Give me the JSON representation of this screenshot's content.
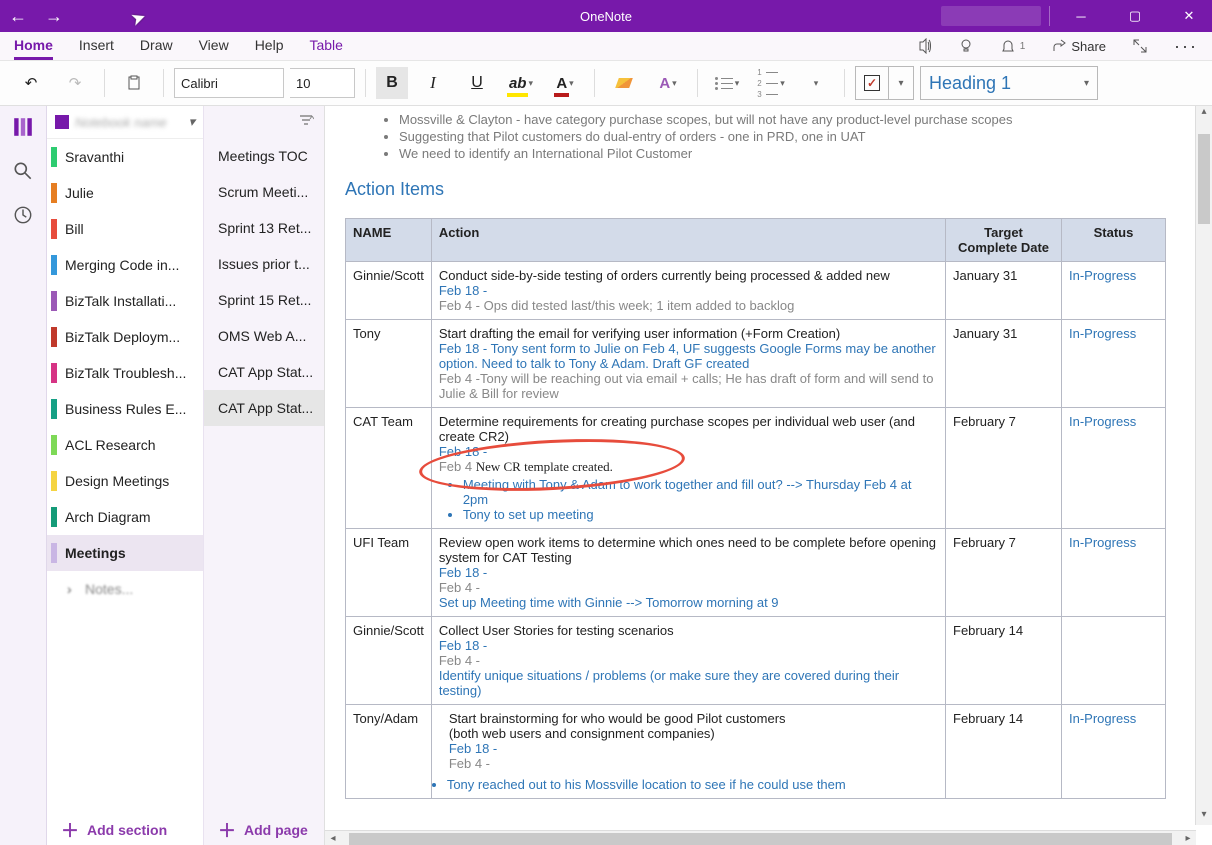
{
  "app": {
    "title": "OneNote"
  },
  "menubar": {
    "home": "Home",
    "insert": "Insert",
    "draw": "Draw",
    "view": "View",
    "help": "Help",
    "table": "Table",
    "share": "Share"
  },
  "ribbon": {
    "fontname": "Calibri",
    "fontsize": "10",
    "styleName": "Heading 1",
    "checkmark": "✓"
  },
  "sections": {
    "items": [
      {
        "label": "Sravanthi",
        "color": "#2ecc71"
      },
      {
        "label": "Julie",
        "color": "#e67e22"
      },
      {
        "label": "Bill",
        "color": "#e74c3c"
      },
      {
        "label": "Merging Code in...",
        "color": "#3498db"
      },
      {
        "label": "BizTalk Installati...",
        "color": "#9b59b6"
      },
      {
        "label": "BizTalk Deploym...",
        "color": "#c0392b"
      },
      {
        "label": "BizTalk Troublesh...",
        "color": "#d63384"
      },
      {
        "label": "Business Rules E...",
        "color": "#16a085"
      },
      {
        "label": "ACL Research",
        "color": "#7ed957"
      },
      {
        "label": "Design Meetings",
        "color": "#f5d442"
      },
      {
        "label": "Arch Diagram",
        "color": "#159b78"
      },
      {
        "label": "Meetings",
        "color": "#c9b6e4",
        "selected": true
      }
    ],
    "child": "Notes...",
    "addSection": "Add section"
  },
  "pages": {
    "items": [
      {
        "label": "Meetings TOC"
      },
      {
        "label": "Scrum Meeti..."
      },
      {
        "label": "Sprint 13 Ret..."
      },
      {
        "label": "Issues prior t..."
      },
      {
        "label": "Sprint 15 Ret..."
      },
      {
        "label": "OMS Web A..."
      },
      {
        "label": "CAT App Stat..."
      },
      {
        "label": "CAT App Stat...",
        "selected": true
      }
    ],
    "addPage": "Add page"
  },
  "note": {
    "bullets": [
      "Mossville & Clayton - have category purchase scopes, but will not have any product-level purchase scopes",
      "Suggesting that Pilot customers do dual-entry of orders - one in PRD, one in UAT",
      "We need to identify an International Pilot Customer"
    ],
    "heading": "Action Items",
    "th": {
      "name": "NAME",
      "action": "Action",
      "tcd": "Target Complete Date",
      "status": "Status"
    },
    "r1": {
      "name": "Ginnie/Scott",
      "a1": "Conduct side-by-side testing of orders currently being processed & added new",
      "a2": "Feb 18 -",
      "a3": "Feb 4 - Ops did tested last/this week; 1 item added to backlog",
      "tcd": "January 31",
      "status": "In-Progress"
    },
    "r2": {
      "name": "Tony",
      "a1": "Start drafting the email for verifying user information (+Form Creation)",
      "a2": "Feb 18 - Tony sent form to Julie on Feb 4,    UF suggests Google Forms may be another option.  Need to talk to Tony & Adam.  Draft GF created",
      "a3": "Feb 4 -Tony will be reaching out via email + calls; He has draft of form and will send to Julie & Bill for review",
      "tcd": "January 31",
      "status": "In-Progress"
    },
    "r3": {
      "name": "CAT Team",
      "a1": "Determine requirements for creating purchase scopes per individual web user (and create CR2)",
      "a2": "Feb 18 -",
      "a3": "Feb 4 ",
      "a4": "New CR template created.",
      "b1": "Meeting with Tony & Adam to work together and fill out? --> Thursday Feb 4 at 2pm",
      "b2": "Tony to set up meeting",
      "tcd": "February 7",
      "status": "In-Progress"
    },
    "r4": {
      "name": "UFI Team",
      "a1": "Review open work items to determine which ones need to be complete before opening system for CAT Testing",
      "a2": "Feb 18 -",
      "a3": "Feb 4 -",
      "a4": "Set up Meeting time with Ginnie --> Tomorrow morning at 9",
      "tcd": "February 7",
      "status": "In-Progress"
    },
    "r5": {
      "name": "Ginnie/Scott",
      "a1": "Collect User Stories for testing scenarios",
      "a2": "Feb 18 -",
      "a3": "Feb 4 -",
      "a4": "Identify unique situations / problems  (or make sure they are covered during their testing)",
      "tcd": "February 14",
      "status": ""
    },
    "r6": {
      "name": "Tony/Adam",
      "a1": "Start brainstorming for who would be good Pilot customers",
      "a2": "(both web users and consignment companies)",
      "a3": "Feb 18 -",
      "a4": "Feb 4 -",
      "b1": "Tony reached out to his Mossville location to see if he could use them",
      "tcd": "February 14",
      "status": "In-Progress"
    }
  }
}
